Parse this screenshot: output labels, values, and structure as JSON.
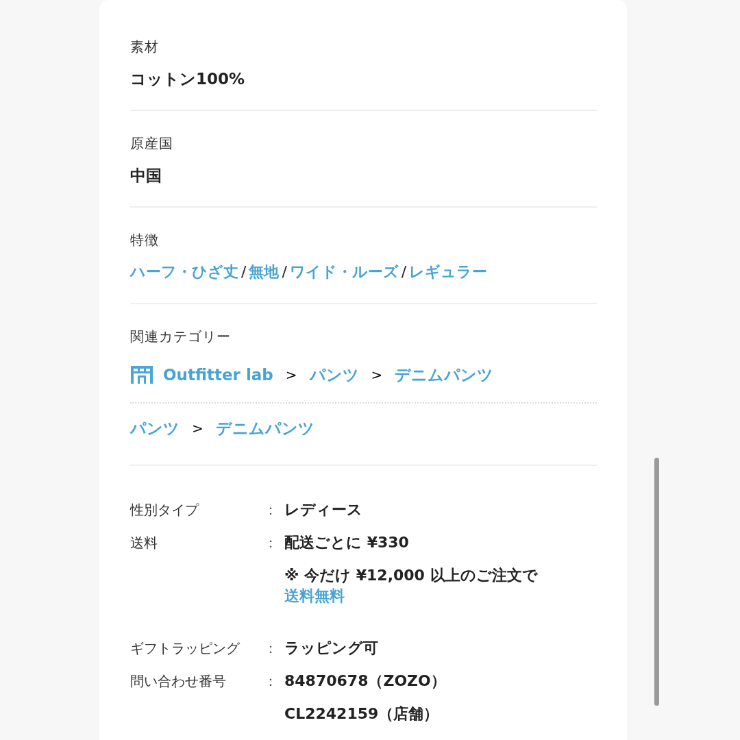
{
  "attributes": [
    {
      "label": "素材",
      "value": "コットン100%"
    },
    {
      "label": "原産国",
      "value": "中国"
    }
  ],
  "features": {
    "label": "特徴",
    "tags": [
      "ハーフ・ひざ丈",
      "無地",
      "ワイド・ルーズ",
      "レギュラー"
    ],
    "separators": [
      "/",
      "/",
      "/"
    ]
  },
  "categories": {
    "label": "関連カテゴリー",
    "paths": [
      {
        "kind": "shop",
        "items": [
          "Outfitter lab",
          "パンツ",
          "デニムパンツ"
        ],
        "separators": [
          ">",
          ">"
        ]
      },
      {
        "kind": "plain",
        "items": [
          "パンツ",
          "デニムパンツ"
        ],
        "separators": [
          ">"
        ]
      }
    ]
  },
  "specs": [
    {
      "label": "性別タイプ",
      "colon": "：",
      "lines": [
        {
          "text": "レディース"
        }
      ]
    },
    {
      "label": "送料",
      "colon": "：",
      "lines": [
        {
          "text": "配送ごとに ¥330"
        },
        {
          "text": "※ 今だけ ¥12,000 以上のご注文で ",
          "link": "送料無料"
        }
      ]
    },
    {
      "label": "ギフトラッピング",
      "colon": "：",
      "lines": [
        {
          "text": "ラッピング可"
        }
      ]
    },
    {
      "label": "問い合わせ番号",
      "colon": "：",
      "lines": [
        {
          "text": "84870678（ZOZO）"
        },
        {
          "text": "CL2242159（店舗）"
        }
      ]
    }
  ]
}
